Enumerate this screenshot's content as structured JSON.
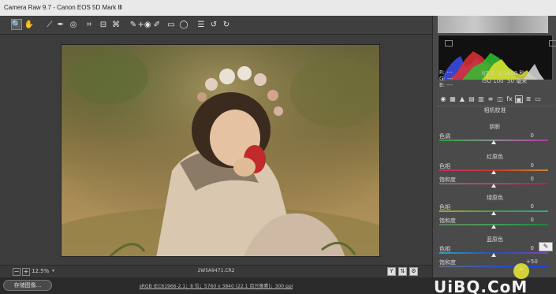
{
  "titlebar": {
    "title": "Camera Raw 9.7 -  Canon EOS 5D Mark Ⅲ"
  },
  "toolbar": {
    "tools": [
      {
        "name": "zoom-tool-icon",
        "glyph": "🔍",
        "active": true
      },
      {
        "name": "hand-tool-icon",
        "glyph": "✋"
      },
      {
        "name": "white-balance-tool-icon",
        "glyph": "⟋"
      },
      {
        "name": "color-sampler-tool-icon",
        "glyph": "✒"
      },
      {
        "name": "targeted-adjustment-tool-icon",
        "glyph": "◎"
      },
      {
        "name": "crop-tool-icon",
        "glyph": "⌗"
      },
      {
        "name": "straighten-tool-icon",
        "glyph": "⊟"
      },
      {
        "name": "transform-tool-icon",
        "glyph": "⌘"
      },
      {
        "name": "spot-removal-tool-icon",
        "glyph": "✎"
      },
      {
        "name": "red-eye-tool-icon",
        "glyph": "+◉"
      },
      {
        "name": "adjustment-brush-icon",
        "glyph": "✐"
      },
      {
        "name": "graduated-filter-icon",
        "glyph": "▭"
      },
      {
        "name": "radial-filter-icon",
        "glyph": "◯"
      },
      {
        "name": "preferences-icon",
        "glyph": "☰"
      },
      {
        "name": "rotate-ccw-icon",
        "glyph": "↺"
      },
      {
        "name": "rotate-cw-icon",
        "glyph": "↻"
      }
    ]
  },
  "bottombar": {
    "zoom_out": "−",
    "zoom_in": "+",
    "zoom_level": "12.5%",
    "filename": "2W5A9471.CR2",
    "view_buttons": [
      "Y",
      "⇅",
      "⚙"
    ]
  },
  "footer": {
    "save_label": "存储图像...",
    "workflow": "sRGB IEC61966-2.1；8 位；5760 x 3840 (22.1 百万像素)；300 ppi"
  },
  "watermark": "UiBQ.CoM",
  "panel": {
    "exif": {
      "left": [
        "R: ---",
        "G: ---",
        "B: ---"
      ],
      "aperture": "f/1.8",
      "shutter": "1/1600 秒",
      "iso": "ISO 100",
      "focal": "50 毫米"
    },
    "section": "相机校准",
    "groups": [
      {
        "title": "阴影",
        "sliders": [
          {
            "label": "色调",
            "value": "0",
            "pos": 0.5,
            "gradient": "linear-gradient(90deg,#2f9e3a,#8d8d8d,#b03aa8)"
          }
        ]
      },
      {
        "title": "红原色",
        "sliders": [
          {
            "label": "色相",
            "value": "0",
            "pos": 0.5,
            "gradient": "linear-gradient(90deg,#c0306a,#c23a2c,#c68a2a)"
          },
          {
            "label": "饱和度",
            "value": "0",
            "pos": 0.5,
            "gradient": "linear-gradient(90deg,#8a6a6a,#b0407a,#c02040)"
          }
        ]
      },
      {
        "title": "绿原色",
        "sliders": [
          {
            "label": "色相",
            "value": "0",
            "pos": 0.5,
            "gradient": "linear-gradient(90deg,#b0a030,#40a040,#30a0a0)"
          },
          {
            "label": "饱和度",
            "value": "0",
            "pos": 0.5,
            "gradient": "linear-gradient(90deg,#6a7a6a,#40a050,#208040)"
          }
        ]
      },
      {
        "title": "蓝原色",
        "sliders": [
          {
            "label": "色相",
            "value": "0",
            "pos": 0.5,
            "gradient": "linear-gradient(90deg,#30a0c0,#2050c0,#8040c0)"
          },
          {
            "label": "饱和度",
            "value": "+50",
            "pos": 0.75,
            "gradient": "linear-gradient(90deg,#6a6a7a,#3050c0,#2040d0)"
          }
        ]
      }
    ]
  }
}
